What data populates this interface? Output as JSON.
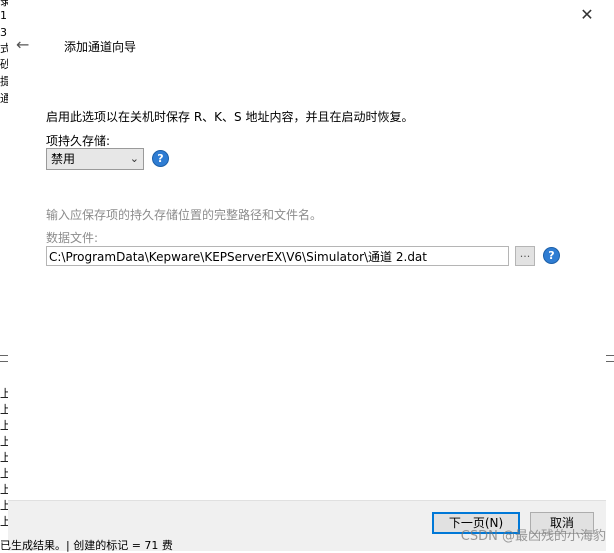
{
  "background": {
    "left_chars": [
      "录",
      "1",
      "3",
      "式",
      "砂",
      "提",
      "通"
    ],
    "left_marks": [
      "上",
      "上",
      "上",
      "上",
      "上",
      "上",
      "上",
      "上",
      "上",
      "上",
      "上"
    ],
    "bottom_text": "已生成结果。| 创建的标记 = 71 费"
  },
  "dialog": {
    "title": "添加通道向导",
    "description": "启用此选项以在关机时保存 R、K、S 地址内容，并且在启动时恢复。",
    "persist_label": "项持久存储:",
    "persist_value": "禁用",
    "hint": "输入应保存项的持久存储位置的完整路径和文件名。",
    "file_label": "数据文件:",
    "file_value": "C:\\ProgramData\\Kepware\\KEPServerEX\\V6\\Simulator\\通道 2.dat",
    "browse_label": "...",
    "help_glyph": "?",
    "close_glyph": "✕",
    "back_glyph": "←",
    "chevron_glyph": "⌄"
  },
  "footer": {
    "next_label": "下一页(N)",
    "cancel_label": "取消"
  },
  "watermark": "CSDN @最凶残的小海豹",
  "colors": {
    "accent": "#0078d7",
    "help_blue": "#2f7dd3",
    "footer_bg": "#f0f0f0",
    "hint_gray": "#8c8c8c"
  }
}
